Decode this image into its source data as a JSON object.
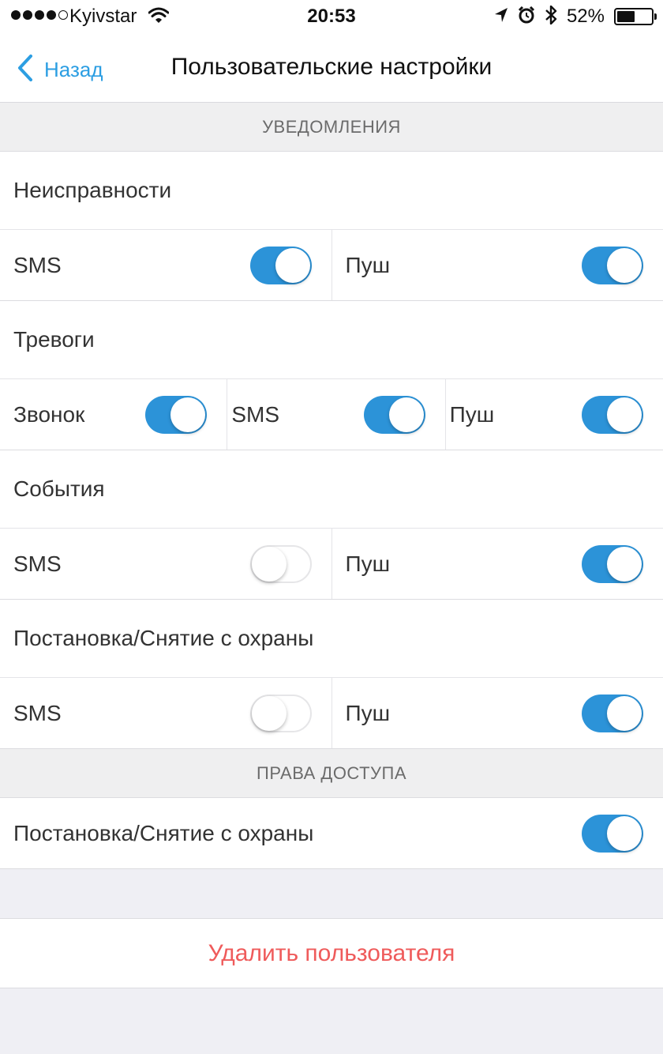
{
  "status_bar": {
    "carrier": "Kyivstar",
    "time": "20:53",
    "battery_percent": "52%",
    "battery_level": 0.52,
    "signal_bars_filled": 4,
    "signal_bars_total": 5,
    "icons": [
      "wifi-icon",
      "location-arrow-icon",
      "alarm-icon",
      "bluetooth-icon",
      "battery-icon"
    ]
  },
  "nav": {
    "back_label": "Назад",
    "title": "Пользовательские настройки"
  },
  "colors": {
    "accent": "#2c9ee2",
    "toggle_on": "#2c93d8",
    "danger": "#ef5b5b",
    "background": "#efeff4"
  },
  "sections": {
    "notifications": "УВЕДОМЛЕНИЯ",
    "access": "ПРАВА ДОСТУПА"
  },
  "groups": {
    "faults": {
      "title": "Неисправности",
      "sms_label": "SMS",
      "sms_on": true,
      "push_label": "Пуш",
      "push_on": true
    },
    "alarms": {
      "title": "Тревоги",
      "call_label": "Звонок",
      "call_on": true,
      "sms_label": "SMS",
      "sms_on": true,
      "push_label": "Пуш",
      "push_on": true
    },
    "events": {
      "title": "События",
      "sms_label": "SMS",
      "sms_on": false,
      "push_label": "Пуш",
      "push_on": true
    },
    "arming": {
      "title": "Постановка/Снятие с охраны",
      "sms_label": "SMS",
      "sms_on": false,
      "push_label": "Пуш",
      "push_on": true
    }
  },
  "access": {
    "arming_label": "Постановка/Снятие с охраны",
    "arming_on": true
  },
  "delete_user_label": "Удалить пользователя"
}
